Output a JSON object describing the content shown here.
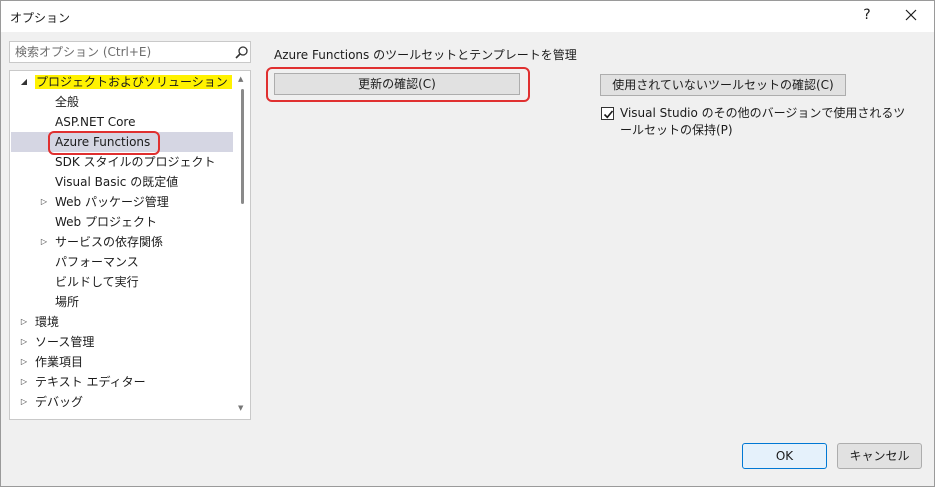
{
  "window": {
    "title": "オプション",
    "help_label": "?"
  },
  "search": {
    "placeholder": "検索オプション (Ctrl+E)"
  },
  "tree": {
    "items": [
      {
        "label": "プロジェクトおよびソリューション",
        "expander": "◢",
        "level": 0,
        "highlighted": true
      },
      {
        "label": "全般",
        "expander": "",
        "level": 1
      },
      {
        "label": "ASP.NET Core",
        "expander": "",
        "level": 1
      },
      {
        "label": "Azure Functions",
        "expander": "",
        "level": 1,
        "selected": true
      },
      {
        "label": "SDK スタイルのプロジェクト",
        "expander": "",
        "level": 1
      },
      {
        "label": "Visual Basic の既定値",
        "expander": "",
        "level": 1
      },
      {
        "label": "Web パッケージ管理",
        "expander": "▷",
        "level": 1
      },
      {
        "label": "Web プロジェクト",
        "expander": "",
        "level": 1
      },
      {
        "label": "サービスの依存関係",
        "expander": "▷",
        "level": 1
      },
      {
        "label": "パフォーマンス",
        "expander": "",
        "level": 1
      },
      {
        "label": "ビルドして実行",
        "expander": "",
        "level": 1
      },
      {
        "label": "場所",
        "expander": "",
        "level": 1
      },
      {
        "label": "環境",
        "expander": "▷",
        "level": 0
      },
      {
        "label": "ソース管理",
        "expander": "▷",
        "level": 0
      },
      {
        "label": "作業項目",
        "expander": "▷",
        "level": 0
      },
      {
        "label": "テキスト エディター",
        "expander": "▷",
        "level": 0
      },
      {
        "label": "デバッグ",
        "expander": "▷",
        "level": 0
      }
    ]
  },
  "panel": {
    "heading": "Azure Functions のツールセットとテンプレートを管理",
    "check_updates_label": "更新の確認(C)",
    "check_unused_label": "使用されていないツールセットの確認(C)",
    "keep_toolsets_label": "Visual Studio のその他のバージョンで使用されるツールセットの保持(P)",
    "keep_toolsets_checked": true
  },
  "footer": {
    "ok_label": "OK",
    "cancel_label": "キャンセル"
  },
  "colors": {
    "highlight": "#fff200",
    "annotation_red": "#e03030",
    "selected_row": "#d5d6e3"
  }
}
